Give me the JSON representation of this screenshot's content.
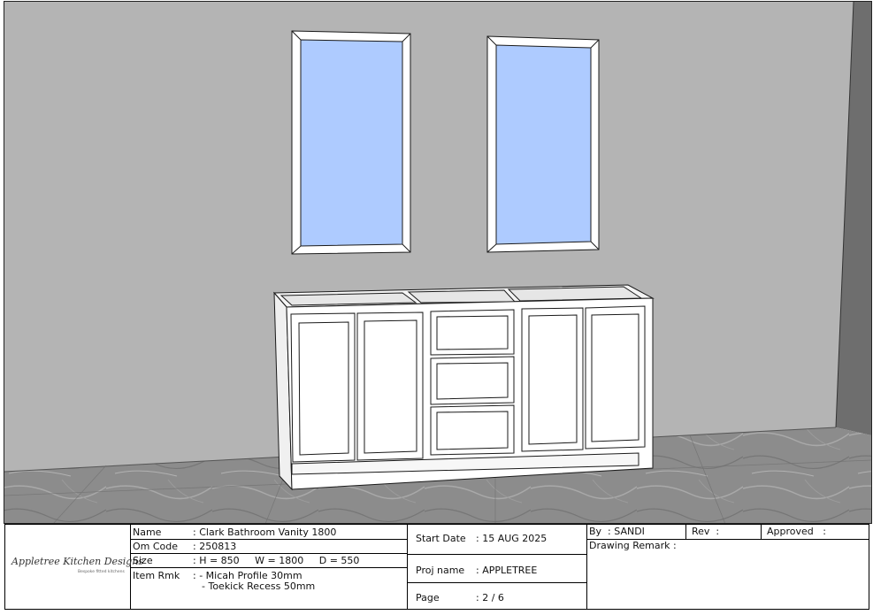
{
  "logo": {
    "name": "Appletree Kitchen Designs",
    "tagline": "Bespoke fitted kitchens"
  },
  "item": {
    "name_label": "Name",
    "name_value": ": Clark Bathroom Vanity 1800",
    "code_label": "Om Code",
    "code_value": ": 250813",
    "size_label": "Size",
    "size_value": ": H = 850     W = 1800     D = 550",
    "remark_label": "Item Rmk",
    "remark_line1": ": - Micah Profile 30mm",
    "remark_line2": "- Toekick Recess 50mm"
  },
  "project": {
    "start_label": "Start Date",
    "start_value": ": 15 AUG 2025",
    "proj_label": "Proj name",
    "proj_value": ": APPLETREE",
    "page_label": "Page",
    "page_value": ": 2 / 6"
  },
  "approval": {
    "by": "By  : SANDI",
    "rev": "Rev  :",
    "approved": "Approved   :",
    "remark": "Drawing Remark :"
  },
  "colors": {
    "wall": "#b4b4b4",
    "wall_side": "#6e6e6e",
    "floor": "#8a8a8a",
    "glass": "#aecbff",
    "cabinet": "#ffffff",
    "line": "#1a1a1a"
  }
}
